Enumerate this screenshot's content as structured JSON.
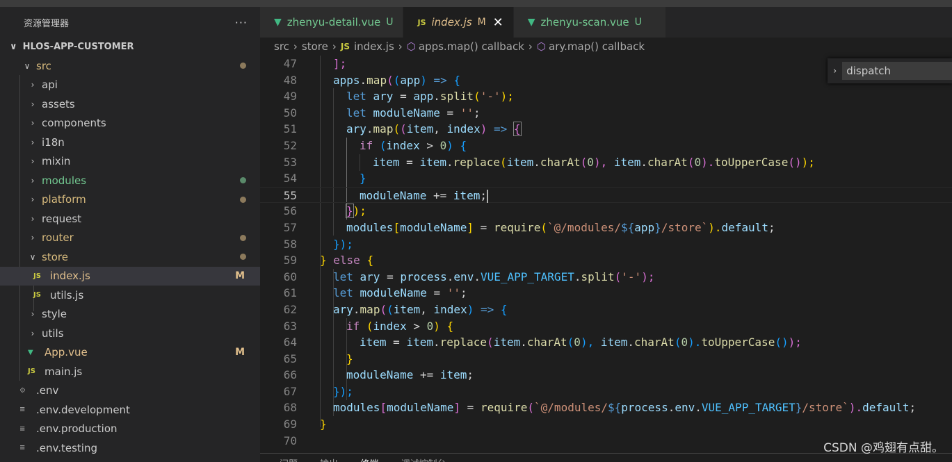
{
  "sidebar": {
    "title": "资源管理器",
    "more": "···",
    "project": "HLOS-APP-CUSTOMER",
    "items": [
      {
        "label": "src"
      },
      {
        "label": "api"
      },
      {
        "label": "assets"
      },
      {
        "label": "components"
      },
      {
        "label": "i18n"
      },
      {
        "label": "mixin"
      },
      {
        "label": "modules"
      },
      {
        "label": "platform"
      },
      {
        "label": "request"
      },
      {
        "label": "router"
      },
      {
        "label": "store"
      },
      {
        "label": "index.js",
        "icon": "JS",
        "badge": "M"
      },
      {
        "label": "utils.js",
        "icon": "JS"
      },
      {
        "label": "style"
      },
      {
        "label": "utils"
      },
      {
        "label": "App.vue",
        "badge": "M"
      },
      {
        "label": "main.js",
        "icon": "JS"
      },
      {
        "label": ".env"
      },
      {
        "label": ".env.development"
      },
      {
        "label": ".env.production"
      },
      {
        "label": ".env.testing"
      }
    ]
  },
  "tabs": [
    {
      "label": "zhenyu-detail.vue",
      "status": "U"
    },
    {
      "label": "index.js",
      "icon": "JS",
      "status": "M",
      "close": "✕"
    },
    {
      "label": "zhenyu-scan.vue",
      "status": "U"
    }
  ],
  "breadcrumb": {
    "items": [
      "src",
      "store",
      "index.js",
      "apps.map() callback",
      "ary.map() callback"
    ],
    "js_icon": "JS"
  },
  "find": {
    "value": "dispatch"
  },
  "editor": {
    "line_numbers": [
      "47",
      "48",
      "49",
      "50",
      "51",
      "52",
      "53",
      "54",
      "55",
      "56",
      "57",
      "58",
      "59",
      "60",
      "61",
      "62",
      "63",
      "64",
      "65",
      "66",
      "67",
      "68",
      "69",
      "70"
    ],
    "current_line": "55",
    "code": {
      "t47_1": "];",
      "t48_1": "apps",
      "t48_2": ".",
      "t48_3": "map",
      "t48_4": "(",
      "t48_5": "(",
      "t48_6": "app",
      "t48_7": ") ",
      "t48_8": "=>",
      "t48_9": " {",
      "t49_1": "let",
      "t49_2": " ary",
      "t49_3": " = ",
      "t49_4": "app",
      "t49_5": ".",
      "t49_6": "split",
      "t49_7": "(",
      "t49_8": "'-'",
      "t49_9": ");",
      "t50_1": "let",
      "t50_2": " moduleName",
      "t50_3": " = ",
      "t50_4": "''",
      "t50_5": ";",
      "t51_1": "ary",
      "t51_2": ".",
      "t51_3": "map",
      "t51_4": "(",
      "t51_5": "(",
      "t51_6": "item",
      "t51_7": ", ",
      "t51_8": "index",
      "t51_9": ") ",
      "t51_10": "=>",
      "t51_11": " ",
      "t51_12": "{",
      "t52_1": "if",
      "t52_2": " (",
      "t52_3": "index",
      "t52_4": " > ",
      "t52_5": "0",
      "t52_6": ") {",
      "t53_1": "item",
      "t53_2": " = ",
      "t53_3": "item",
      "t53_4": ".",
      "t53_5": "replace",
      "t53_6": "(",
      "t53_7": "item",
      "t53_8": ".",
      "t53_9": "charAt",
      "t53_10": "(",
      "t53_11": "0",
      "t53_12": "), ",
      "t53_13": "item",
      "t53_14": ".",
      "t53_15": "charAt",
      "t53_16": "(",
      "t53_17": "0",
      "t53_18": ").",
      "t53_19": "toUpperCase",
      "t53_20": "()",
      "t53_21": ");",
      "t54_1": "}",
      "t55_1": "moduleName",
      "t55_2": " += ",
      "t55_3": "item",
      "t55_4": ";",
      "t56_1": "}",
      "t56_2": ");",
      "t57_1": "modules",
      "t57_2": "[",
      "t57_3": "moduleName",
      "t57_4": "]",
      "t57_5": " = ",
      "t57_6": "require",
      "t57_7": "(",
      "t57_8": "`@/modules/",
      "t57_9": "${",
      "t57_10": "app",
      "t57_11": "}",
      "t57_12": "/store`",
      "t57_13": ").",
      "t57_14": "default",
      "t57_15": ";",
      "t58_1": "});",
      "t59_1": "}",
      "t59_2": " else ",
      "t59_3": "{",
      "t60_1": "let",
      "t60_2": " ary",
      "t60_3": " = ",
      "t60_4": "process",
      "t60_5": ".",
      "t60_6": "env",
      "t60_7": ".",
      "t60_8": "VUE_APP_TARGET",
      "t60_9": ".",
      "t60_10": "split",
      "t60_11": "(",
      "t60_12": "'-'",
      "t60_13": ");",
      "t61_1": "let",
      "t61_2": " moduleName",
      "t61_3": " = ",
      "t61_4": "''",
      "t61_5": ";",
      "t62_1": "ary",
      "t62_2": ".",
      "t62_3": "map",
      "t62_4": "(",
      "t62_5": "(",
      "t62_6": "item",
      "t62_7": ", ",
      "t62_8": "index",
      "t62_9": ") ",
      "t62_10": "=>",
      "t62_11": " {",
      "t63_1": "if",
      "t63_2": " (",
      "t63_3": "index",
      "t63_4": " > ",
      "t63_5": "0",
      "t63_6": ") ",
      "t63_7": "{",
      "t64_1": "item",
      "t64_2": " = ",
      "t64_3": "item",
      "t64_4": ".",
      "t64_5": "replace",
      "t64_6": "(",
      "t64_7": "item",
      "t64_8": ".",
      "t64_9": "charAt",
      "t64_10": "(",
      "t64_11": "0",
      "t64_12": "), ",
      "t64_13": "item",
      "t64_14": ".",
      "t64_15": "charAt",
      "t64_16": "(",
      "t64_17": "0",
      "t64_18": ").",
      "t64_19": "toUpperCase",
      "t64_20": "()",
      "t64_21": ");",
      "t65_1": "}",
      "t66_1": "moduleName",
      "t66_2": " += ",
      "t66_3": "item",
      "t66_4": ";",
      "t67_1": "});",
      "t68_1": "modules",
      "t68_2": "[",
      "t68_3": "moduleName",
      "t68_4": "]",
      "t68_5": " = ",
      "t68_6": "require",
      "t68_7": "(",
      "t68_8": "`@/modules/",
      "t68_9": "${",
      "t68_10": "process",
      "t68_11": ".",
      "t68_12": "env",
      "t68_13": ".",
      "t68_14": "VUE_APP_TARGET",
      "t68_15": "}",
      "t68_16": "/store`",
      "t68_17": ").",
      "t68_18": "default",
      "t68_19": ";",
      "t69_1": "}"
    }
  },
  "panel": {
    "tabs": [
      "问题",
      "输出",
      "终端",
      "调试控制台"
    ]
  },
  "watermark": "CSDN @鸡翅有点甜。",
  "colors": {
    "sidebar_bg": "#252526",
    "editor_bg": "#1e1e1e",
    "modified": "#e2c08d",
    "untracked": "#73c991",
    "selection": "#37373d"
  }
}
